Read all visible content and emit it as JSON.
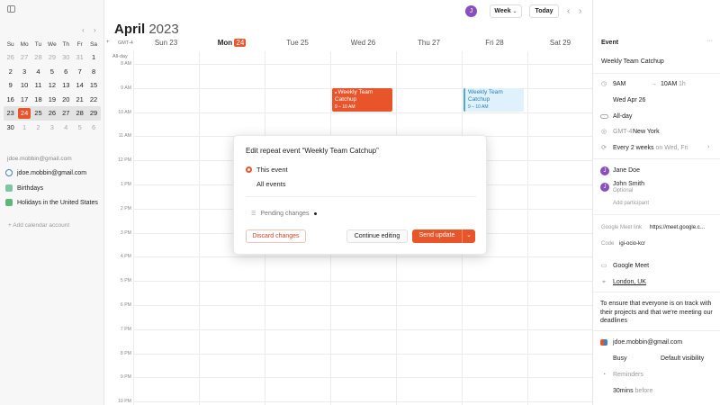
{
  "sidebar": {
    "mini_calendar": {
      "weekdays": [
        "Su",
        "Mo",
        "Tu",
        "We",
        "Th",
        "Fr",
        "Sa"
      ],
      "weeks": [
        [
          {
            "d": "26",
            "dim": true
          },
          {
            "d": "27",
            "dim": true
          },
          {
            "d": "28",
            "dim": true
          },
          {
            "d": "29",
            "dim": true
          },
          {
            "d": "30",
            "dim": true
          },
          {
            "d": "31",
            "dim": true
          },
          {
            "d": "1"
          }
        ],
        [
          {
            "d": "2"
          },
          {
            "d": "3"
          },
          {
            "d": "4"
          },
          {
            "d": "5"
          },
          {
            "d": "6"
          },
          {
            "d": "7"
          },
          {
            "d": "8"
          }
        ],
        [
          {
            "d": "9"
          },
          {
            "d": "10"
          },
          {
            "d": "11"
          },
          {
            "d": "12"
          },
          {
            "d": "13"
          },
          {
            "d": "14"
          },
          {
            "d": "15"
          }
        ],
        [
          {
            "d": "16"
          },
          {
            "d": "17"
          },
          {
            "d": "18"
          },
          {
            "d": "19"
          },
          {
            "d": "20"
          },
          {
            "d": "21"
          },
          {
            "d": "22"
          }
        ],
        [
          {
            "d": "23"
          },
          {
            "d": "24",
            "today": true
          },
          {
            "d": "25"
          },
          {
            "d": "26"
          },
          {
            "d": "27"
          },
          {
            "d": "28"
          },
          {
            "d": "29"
          }
        ],
        [
          {
            "d": "30"
          },
          {
            "d": "1",
            "dim": true
          },
          {
            "d": "2",
            "dim": true
          },
          {
            "d": "3",
            "dim": true
          },
          {
            "d": "4",
            "dim": true
          },
          {
            "d": "5",
            "dim": true
          },
          {
            "d": "6",
            "dim": true
          }
        ]
      ],
      "current_week_index": 4
    },
    "account_email": "jdoe.mobbin@gmail.com",
    "calendars": [
      {
        "label": "jdoe.mobbin@gmail.com",
        "color": "#3b82c4"
      },
      {
        "label": "Birthdays",
        "color": "#7fc4a4"
      },
      {
        "label": "Holidays in the United States",
        "color": "#5cb87a"
      }
    ],
    "add_account_label": "+ Add calendar account"
  },
  "header": {
    "month": "April",
    "year": "2023",
    "avatar_letter": "J",
    "view_label": "Week",
    "today_label": "Today"
  },
  "week": {
    "timezone_label": "GMT-4",
    "allday_label": "All-day",
    "days": [
      {
        "label": "Sun 23"
      },
      {
        "label": "Mon",
        "badge": "24",
        "today": true
      },
      {
        "label": "Tue 25"
      },
      {
        "label": "Wed 26"
      },
      {
        "label": "Thu 27"
      },
      {
        "label": "Fri 28"
      },
      {
        "label": "Sat 29"
      }
    ],
    "hours": [
      "8 AM",
      "9 AM",
      "10 AM",
      "11 AM",
      "12 PM",
      "1 PM",
      "2 PM",
      "3 PM",
      "4 PM",
      "5 PM",
      "6 PM",
      "7 PM",
      "8 PM",
      "9 PM",
      "10 PM"
    ],
    "events": [
      {
        "day": 3,
        "title": "Weekly Team Catchup",
        "time": "9 – 10 AM",
        "style": "solid",
        "pending_mark": true
      },
      {
        "day": 5,
        "title": "Weekly Team Catchup",
        "time": "9 – 10 AM",
        "style": "light"
      }
    ]
  },
  "dialog": {
    "title": "Edit repeat event “Weekly Team Catchup”",
    "options": [
      "This event",
      "All events"
    ],
    "pending_label": "Pending changes",
    "discard_label": "Discard changes",
    "continue_label": "Continue editing",
    "send_label": "Send update"
  },
  "panel": {
    "header": "Event",
    "title": "Weekly Team Catchup",
    "start_time": "9AM",
    "end_time": "10AM",
    "duration": "1h",
    "date": "Wed Apr 26",
    "allday_label": "All-day",
    "timezone": "GMT-4",
    "timezone_city": "New York",
    "recurrence": "Every 2 weeks",
    "recurrence_detail": "on Wed, Fri",
    "participants": [
      {
        "name": "Jane Doe",
        "note": ""
      },
      {
        "name": "John Smith",
        "note": "Optional"
      }
    ],
    "add_participant": "Add participant",
    "meet_label": "Google Meet link",
    "meet_link": "https://meet.google.c…",
    "code_label": "Code",
    "code": "igi-ocio-kcr",
    "conference": "Google Meet",
    "location": "London, UK",
    "description": "To ensure that everyone is on track with their projects and that we're meeting our deadlines",
    "organizer": "jdoe.mobbin@gmail.com",
    "busy": "Busy",
    "visibility": "Default visibility",
    "reminders_label": "Reminders",
    "reminder_value": "30mins",
    "reminder_suffix": "before"
  },
  "colors": {
    "accent": "#e8552b",
    "event_light": "#dff1fb",
    "event_light_border": "#4aa8de"
  }
}
